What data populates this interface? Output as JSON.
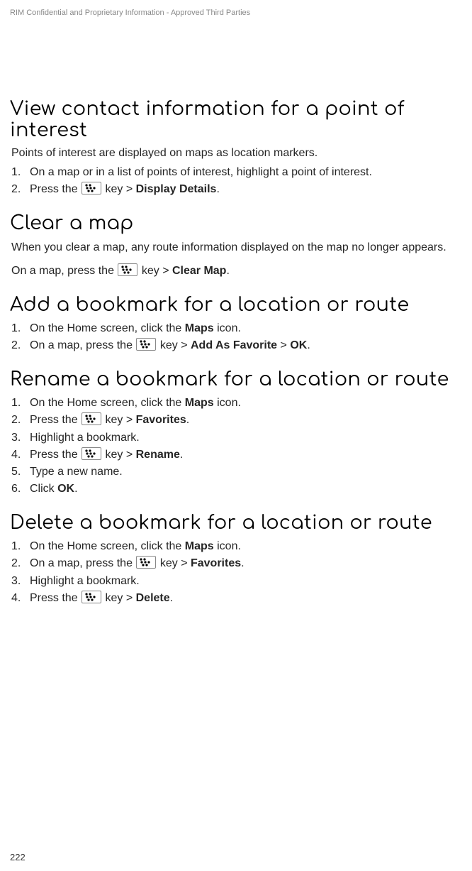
{
  "header": "RIM Confidential and Proprietary Information - Approved Third Parties",
  "pagenum": "222",
  "sections": {
    "view": {
      "title": "View contact information for a point of interest",
      "intro": "Points of interest are displayed on maps as location markers.",
      "steps": [
        {
          "num": "1.",
          "pre": "On a map or in a list of points of interest, highlight a point of interest."
        },
        {
          "num": "2.",
          "pre": "Press the ",
          "post": " key > ",
          "b1": "Display Details",
          "tail": "."
        }
      ]
    },
    "clear": {
      "title": "Clear a map",
      "intro": "When you clear a map, any route information displayed on the map no longer appears.",
      "step_pre": "On a map, press the ",
      "step_post": " key > ",
      "step_b1": "Clear Map",
      "step_tail": "."
    },
    "add": {
      "title": "Add a bookmark for a location or route",
      "steps": [
        {
          "num": "1.",
          "pre": "On the Home screen, click the ",
          "b1": "Maps",
          "mid": " icon."
        },
        {
          "num": "2.",
          "pre": "On a map, press the ",
          "post": " key > ",
          "b1": "Add As Favorite",
          "sep": " > ",
          "b2": "OK",
          "tail": "."
        }
      ]
    },
    "rename": {
      "title": "Rename a bookmark for a location or route",
      "steps": [
        {
          "num": "1.",
          "pre": "On the Home screen, click the ",
          "b1": "Maps",
          "mid": " icon."
        },
        {
          "num": "2.",
          "pre": "Press the ",
          "post": " key > ",
          "b1": "Favorites",
          "tail": "."
        },
        {
          "num": "3.",
          "pre": "Highlight a bookmark."
        },
        {
          "num": "4.",
          "pre": "Press the ",
          "post": " key > ",
          "b1": "Rename",
          "tail": "."
        },
        {
          "num": "5.",
          "pre": "Type a new name."
        },
        {
          "num": "6.",
          "pre": "Click ",
          "b1": "OK",
          "tail": "."
        }
      ]
    },
    "delete": {
      "title": "Delete a bookmark for a location or route",
      "steps": [
        {
          "num": "1.",
          "pre": "On the Home screen, click the ",
          "b1": "Maps",
          "mid": " icon."
        },
        {
          "num": "2.",
          "pre": "On a map, press the ",
          "post": " key > ",
          "b1": "Favorites",
          "tail": "."
        },
        {
          "num": "3.",
          "pre": "Highlight a bookmark."
        },
        {
          "num": "4.",
          "pre": "Press the ",
          "post": " key > ",
          "b1": "Delete",
          "tail": "."
        }
      ]
    }
  }
}
